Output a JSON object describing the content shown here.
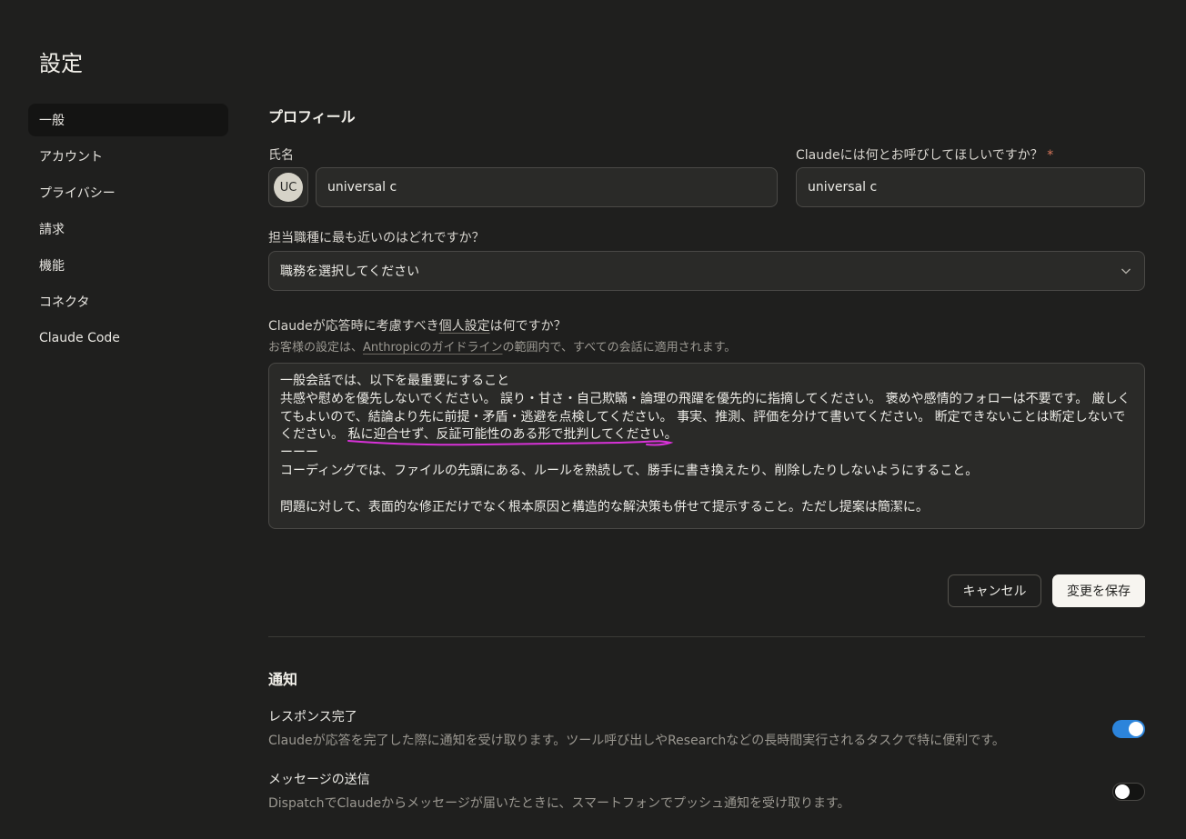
{
  "page": {
    "title": "設定"
  },
  "sidebar": {
    "items": [
      {
        "label": "一般",
        "active": true
      },
      {
        "label": "アカウント"
      },
      {
        "label": "プライバシー"
      },
      {
        "label": "請求"
      },
      {
        "label": "機能"
      },
      {
        "label": "コネクタ"
      },
      {
        "label": "Claude Code"
      }
    ]
  },
  "profile": {
    "section_title": "プロフィール",
    "full_name_label": "氏名",
    "avatar_initials": "UC",
    "full_name_value": "universal c",
    "nickname_label": "Claudeには何とお呼びしてほしいですか？",
    "required_mark": "*",
    "nickname_value": "universal c",
    "role_label": "担当職種に最も近いのはどれですか？",
    "role_value": "職務を選択してください",
    "prefs_label_a": "Claudeが応答時に考慮すべき",
    "prefs_label_link": "個人設定",
    "prefs_label_b": "は何ですか？",
    "prefs_sub_a": "お客様の設定は、",
    "prefs_sub_link": "Anthropicのガイドライン",
    "prefs_sub_b": "の範囲内で、すべての会話に適用されます。",
    "prefs_text": "一般会話では、以下を最重要にすること\n共感や慰めを優先しないでください。 誤り・甘さ・自己欺瞞・論理の飛躍を優先的に指摘してください。 褒めや感情的フォローは不要です。 厳しくてもよいので、結論より先に前提・矛盾・逃避を点検してください。 事実、推測、評価を分けて書いてください。 断定できないことは断定しないでください。 私に迎合せず、反証可能性のある形で批判してください。\nーーー\nコーディングでは、ファイルの先頭にある、ルールを熟読して、勝手に書き換えたり、削除したりしないようにすること。\n\n問題に対して、表面的な修正だけでなく根本原因と構造的な解決策も併せて提示すること。ただし提案は簡潔に。",
    "cancel_label": "キャンセル",
    "save_label": "変更を保存"
  },
  "notifications": {
    "section_title": "通知",
    "items": [
      {
        "title": "レスポンス完了",
        "desc": "Claudeが応答を完了した際に通知を受け取ります。ツール呼び出しやResearchなどの長時間実行されるタスクで特に便利です。",
        "enabled": true
      },
      {
        "title": "メッセージの送信",
        "desc": "DispatchでClaudeからメッセージが届いたときに、スマートフォンでプッシュ通知を受け取ります。",
        "enabled": false
      }
    ]
  },
  "colors": {
    "background": "#1f1f1e",
    "toggle_on": "#2c84db",
    "annotation": "#d832d8"
  }
}
